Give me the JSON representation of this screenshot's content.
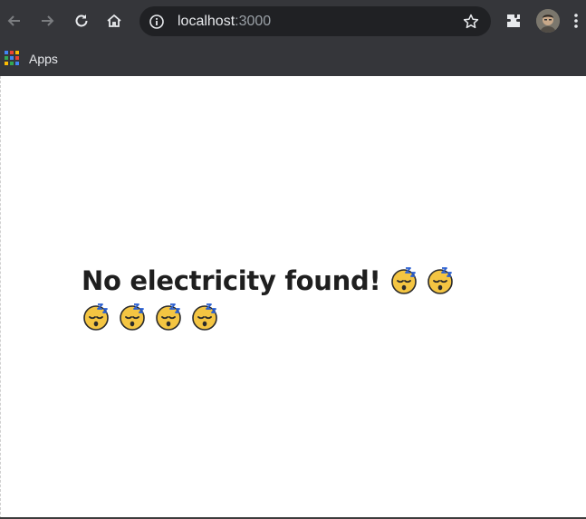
{
  "browser": {
    "url_host": "localhost",
    "url_port": ":3000",
    "bookmarks": [
      {
        "label": "Apps",
        "icon": "apps-grid-icon"
      }
    ]
  },
  "colors": {
    "chrome_bg": "#35363a",
    "omnibox_bg": "#202124",
    "page_bg": "#ffffff",
    "text": "#1f1f1f"
  },
  "page": {
    "message": "No electricity found!",
    "emoji_icon": "sleeping-face-icon",
    "emoji_count": 6
  }
}
